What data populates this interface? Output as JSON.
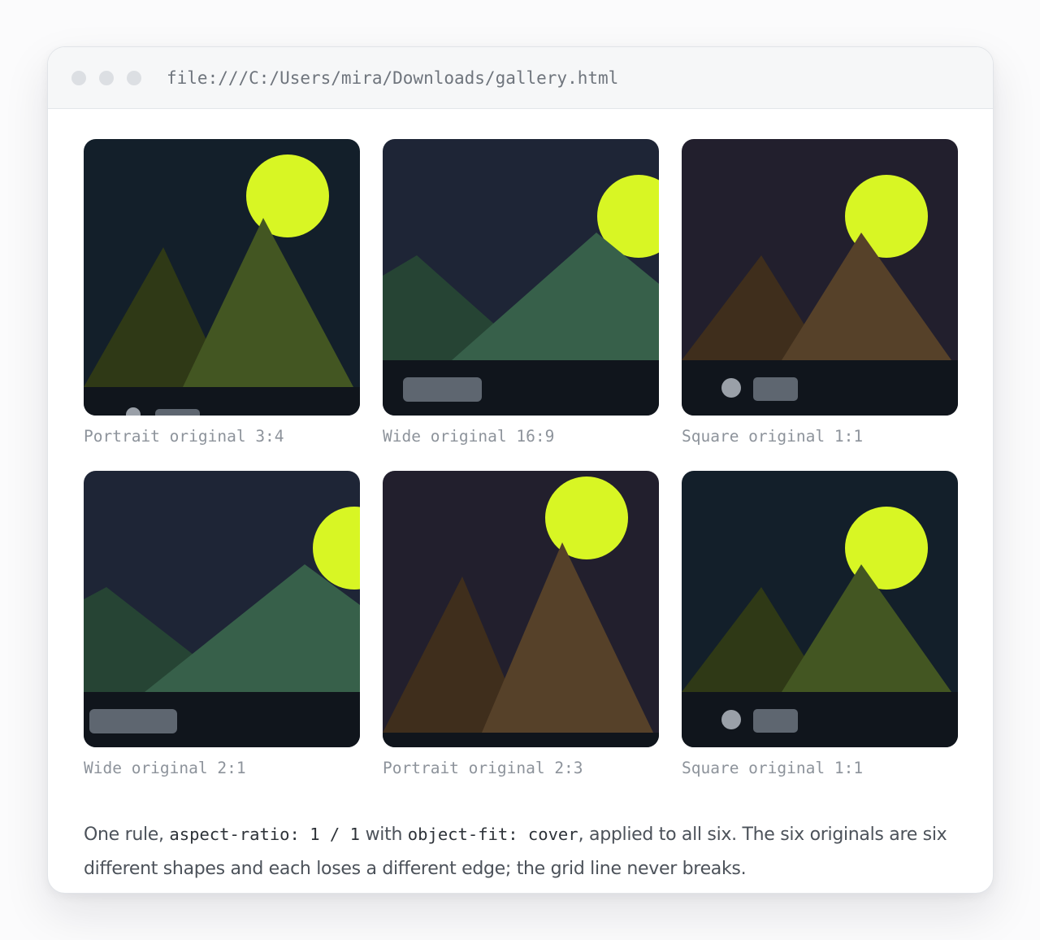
{
  "browser": {
    "address": "file:///C:/Users/mira/Downloads/gallery.html"
  },
  "gallery": {
    "items": [
      {
        "caption": "Portrait original 3:4"
      },
      {
        "caption": "Wide original 16:9"
      },
      {
        "caption": "Square original 1:1"
      },
      {
        "caption": "Wide original 2:1"
      },
      {
        "caption": "Portrait original 2:3"
      },
      {
        "caption": "Square original 1:1"
      }
    ]
  },
  "note": {
    "text_1": "One rule, ",
    "code_1": "aspect-ratio: 1 / 1",
    "text_2": " with ",
    "code_2": "object-fit: cover",
    "text_3": ", applied to all six. The six originals are six different shapes and each loses a different edge; the grid line never breaks."
  },
  "colors": {
    "sun": "#d8f624",
    "ground": "#10151c",
    "pill": "#5e6670",
    "dot_light": "#9aa0a8"
  }
}
